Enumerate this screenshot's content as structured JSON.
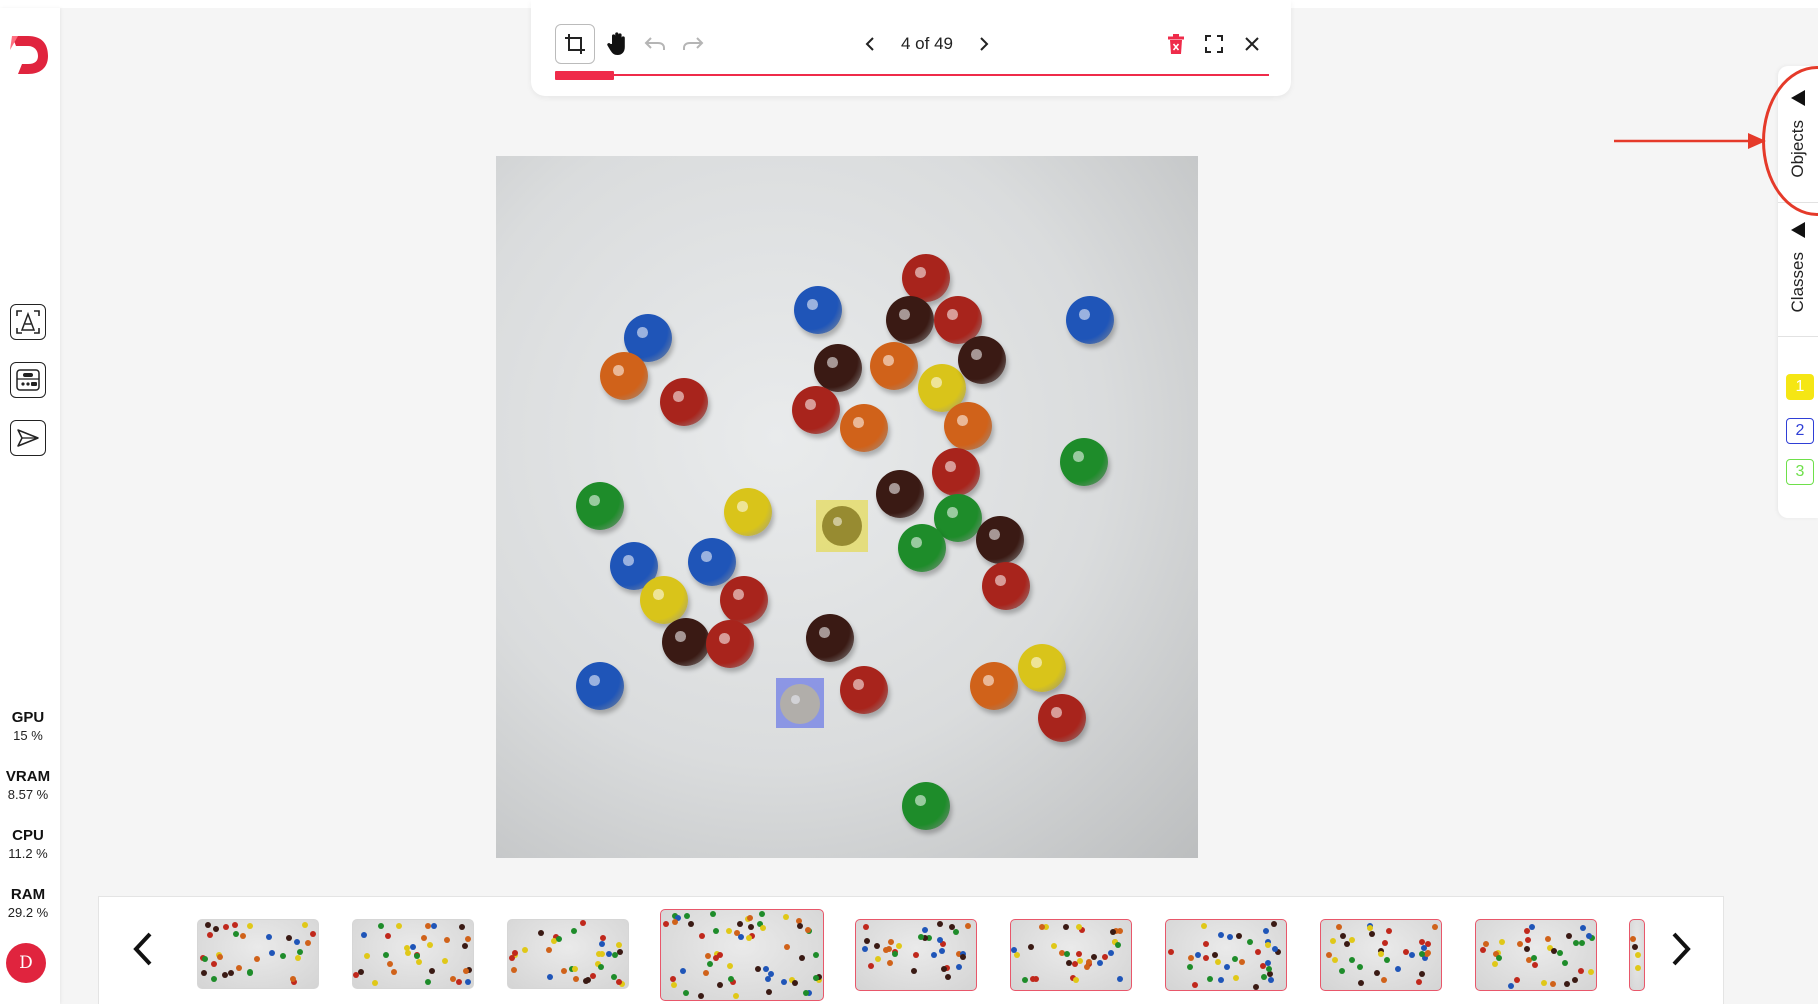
{
  "app": {
    "logo_text": "D",
    "brand_color": "#e0243e",
    "accent_color": "#ef2b4a"
  },
  "sidebar": {
    "tools": [
      {
        "name": "auto-annotate-icon"
      },
      {
        "name": "model-settings-icon"
      },
      {
        "name": "send-icon"
      }
    ],
    "stats": [
      {
        "label": "GPU",
        "value": "15 %"
      },
      {
        "label": "VRAM",
        "value": "8.57 %"
      },
      {
        "label": "CPU",
        "value": "11.2 %"
      },
      {
        "label": "RAM",
        "value": "29.2 %"
      }
    ],
    "avatar_initial": "D"
  },
  "toolbar": {
    "tools": [
      "crop-icon",
      "hand-pan-icon",
      "undo-icon",
      "redo-icon"
    ],
    "page_indicator": "4 of 49",
    "progress_fraction": 0.082,
    "right_tools": [
      "delete-icon",
      "fullscreen-icon",
      "close-icon"
    ]
  },
  "right_panel": {
    "tabs": [
      {
        "label": "Objects"
      },
      {
        "label": "Classes"
      }
    ],
    "class_badges": [
      {
        "label": "1",
        "color": "#f5e614"
      },
      {
        "label": "2",
        "color": "#2f3fd6"
      },
      {
        "label": "3",
        "color": "#6ee04a"
      }
    ]
  },
  "filmstrip": {
    "selected_index": 3,
    "thumbnail_count": 10
  }
}
